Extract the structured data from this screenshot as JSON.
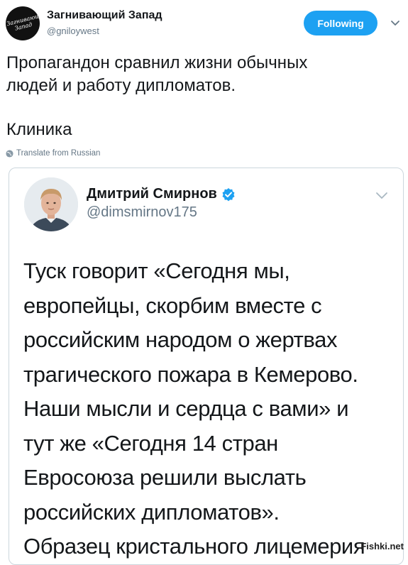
{
  "author": {
    "name": "Загнивающий Запад",
    "handle": "@gniloywest",
    "avatar_text": "Загнивающий Запад"
  },
  "follow_button": {
    "label": "Following",
    "color": "#1da1f2"
  },
  "tweet": {
    "lines": [
      "Пропагандон сравнил жизни обычных",
      "людей и работу дипломатов."
    ],
    "final_line": "Клиника"
  },
  "translate": {
    "label": "Translate from Russian",
    "icon": "globe-icon"
  },
  "quoted_tweet": {
    "author_name": "Дмитрий Смирнов",
    "verified": true,
    "handle": "@dimsmirnov175",
    "text_lines": [
      "Туск говорит «Сегодня мы,",
      "европейцы, скорбим вместе с",
      "российским народом о жертвах",
      "трагического пожара в Кемерово.",
      "Наши мысли и сердца с вами» и",
      "тут же «Сегодня 14 стран",
      "Евросоюза решили выслать",
      "российских дипломатов».",
      "Образец кристального лицемерия"
    ]
  },
  "watermark": "Fishki.net",
  "colors": {
    "link_blue": "#1da1f2",
    "text": "#14171a",
    "secondary": "#657786",
    "border": "#ccd6dd"
  }
}
